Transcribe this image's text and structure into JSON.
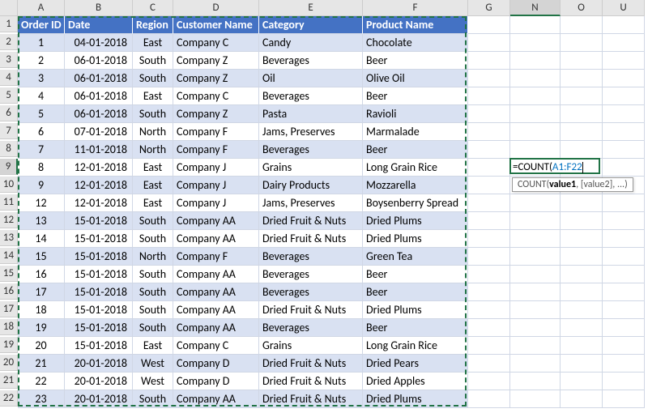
{
  "columns": [
    "A",
    "B",
    "C",
    "D",
    "E",
    "F",
    "G",
    "N",
    "O",
    "U"
  ],
  "active_column": "N",
  "active_row": 9,
  "headers": [
    "Order ID",
    "Date",
    "Region",
    "Customer Name",
    "Category",
    "Product Name"
  ],
  "rows": [
    {
      "n": 1,
      "id": "1",
      "date": "04-01-2018",
      "region": "East",
      "cust": "Company C",
      "cat": "Candy",
      "prod": "Chocolate"
    },
    {
      "n": 2,
      "id": "2",
      "date": "06-01-2018",
      "region": "South",
      "cust": "Company Z",
      "cat": "Beverages",
      "prod": "Beer"
    },
    {
      "n": 3,
      "id": "3",
      "date": "06-01-2018",
      "region": "South",
      "cust": "Company Z",
      "cat": "Oil",
      "prod": "Olive Oil"
    },
    {
      "n": 4,
      "id": "4",
      "date": "06-01-2018",
      "region": "East",
      "cust": "Company C",
      "cat": "Beverages",
      "prod": "Beer"
    },
    {
      "n": 5,
      "id": "5",
      "date": "06-01-2018",
      "region": "South",
      "cust": "Company Z",
      "cat": "Pasta",
      "prod": "Ravioli"
    },
    {
      "n": 6,
      "id": "6",
      "date": "07-01-2018",
      "region": "North",
      "cust": "Company F",
      "cat": "Jams, Preserves",
      "prod": "Marmalade"
    },
    {
      "n": 7,
      "id": "7",
      "date": "11-01-2018",
      "region": "North",
      "cust": "Company F",
      "cat": "Beverages",
      "prod": "Beer"
    },
    {
      "n": 8,
      "id": "8",
      "date": "12-01-2018",
      "region": "East",
      "cust": "Company J",
      "cat": "Grains",
      "prod": "Long Grain Rice"
    },
    {
      "n": 9,
      "id": "9",
      "date": "12-01-2018",
      "region": "East",
      "cust": "Company J",
      "cat": "Dairy Products",
      "prod": "Mozzarella"
    },
    {
      "n": 10,
      "id": "12",
      "date": "12-01-2018",
      "region": "East",
      "cust": "Company J",
      "cat": "Jams, Preserves",
      "prod": "Boysenberry Spread"
    },
    {
      "n": 11,
      "id": "13",
      "date": "15-01-2018",
      "region": "South",
      "cust": "Company AA",
      "cat": "Dried Fruit & Nuts",
      "prod": "Dried Plums"
    },
    {
      "n": 12,
      "id": "14",
      "date": "15-01-2018",
      "region": "South",
      "cust": "Company AA",
      "cat": "Dried Fruit & Nuts",
      "prod": "Dried Plums"
    },
    {
      "n": 13,
      "id": "15",
      "date": "15-01-2018",
      "region": "North",
      "cust": "Company F",
      "cat": "Beverages",
      "prod": "Green Tea"
    },
    {
      "n": 14,
      "id": "16",
      "date": "15-01-2018",
      "region": "South",
      "cust": "Company AA",
      "cat": "Beverages",
      "prod": "Beer"
    },
    {
      "n": 15,
      "id": "17",
      "date": "15-01-2018",
      "region": "South",
      "cust": "Company AA",
      "cat": "Beverages",
      "prod": "Beer"
    },
    {
      "n": 16,
      "id": "18",
      "date": "15-01-2018",
      "region": "South",
      "cust": "Company AA",
      "cat": "Dried Fruit & Nuts",
      "prod": "Dried Plums"
    },
    {
      "n": 17,
      "id": "19",
      "date": "15-01-2018",
      "region": "South",
      "cust": "Company AA",
      "cat": "Beverages",
      "prod": "Beer"
    },
    {
      "n": 18,
      "id": "20",
      "date": "15-01-2018",
      "region": "East",
      "cust": "Company C",
      "cat": "Grains",
      "prod": "Long Grain Rice"
    },
    {
      "n": 19,
      "id": "21",
      "date": "20-01-2018",
      "region": "West",
      "cust": "Company D",
      "cat": "Dried Fruit & Nuts",
      "prod": "Dried Pears"
    },
    {
      "n": 20,
      "id": "22",
      "date": "20-01-2018",
      "region": "West",
      "cust": "Company D",
      "cat": "Dried Fruit & Nuts",
      "prod": "Dried Apples"
    },
    {
      "n": 21,
      "id": "23",
      "date": "20-01-2018",
      "region": "South",
      "cust": "Company AA",
      "cat": "Dried Fruit & Nuts",
      "prod": "Dried Plums"
    }
  ],
  "formula": {
    "prefix": "=COUNT(",
    "ref": "A1:F22"
  },
  "tooltip": {
    "fn": "COUNT(",
    "arg1": "value1",
    "rest": ", [value2], ...)"
  },
  "chart_data": {
    "type": "table",
    "title": "",
    "columns": [
      "Order ID",
      "Date",
      "Region",
      "Customer Name",
      "Category",
      "Product Name"
    ],
    "data": [
      [
        1,
        "04-01-2018",
        "East",
        "Company C",
        "Candy",
        "Chocolate"
      ],
      [
        2,
        "06-01-2018",
        "South",
        "Company Z",
        "Beverages",
        "Beer"
      ],
      [
        3,
        "06-01-2018",
        "South",
        "Company Z",
        "Oil",
        "Olive Oil"
      ],
      [
        4,
        "06-01-2018",
        "East",
        "Company C",
        "Beverages",
        "Beer"
      ],
      [
        5,
        "06-01-2018",
        "South",
        "Company Z",
        "Pasta",
        "Ravioli"
      ],
      [
        6,
        "07-01-2018",
        "North",
        "Company F",
        "Jams, Preserves",
        "Marmalade"
      ],
      [
        7,
        "11-01-2018",
        "North",
        "Company F",
        "Beverages",
        "Beer"
      ],
      [
        8,
        "12-01-2018",
        "East",
        "Company J",
        "Grains",
        "Long Grain Rice"
      ],
      [
        9,
        "12-01-2018",
        "East",
        "Company J",
        "Dairy Products",
        "Mozzarella"
      ],
      [
        12,
        "12-01-2018",
        "East",
        "Company J",
        "Jams, Preserves",
        "Boysenberry Spread"
      ],
      [
        13,
        "15-01-2018",
        "South",
        "Company AA",
        "Dried Fruit & Nuts",
        "Dried Plums"
      ],
      [
        14,
        "15-01-2018",
        "South",
        "Company AA",
        "Dried Fruit & Nuts",
        "Dried Plums"
      ],
      [
        15,
        "15-01-2018",
        "North",
        "Company F",
        "Beverages",
        "Green Tea"
      ],
      [
        16,
        "15-01-2018",
        "South",
        "Company AA",
        "Beverages",
        "Beer"
      ],
      [
        17,
        "15-01-2018",
        "South",
        "Company AA",
        "Beverages",
        "Beer"
      ],
      [
        18,
        "15-01-2018",
        "South",
        "Company AA",
        "Dried Fruit & Nuts",
        "Dried Plums"
      ],
      [
        19,
        "15-01-2018",
        "South",
        "Company AA",
        "Beverages",
        "Beer"
      ],
      [
        20,
        "15-01-2018",
        "East",
        "Company C",
        "Grains",
        "Long Grain Rice"
      ],
      [
        21,
        "20-01-2018",
        "West",
        "Company D",
        "Dried Fruit & Nuts",
        "Dried Pears"
      ],
      [
        22,
        "20-01-2018",
        "West",
        "Company D",
        "Dried Fruit & Nuts",
        "Dried Apples"
      ],
      [
        23,
        "20-01-2018",
        "South",
        "Company AA",
        "Dried Fruit & Nuts",
        "Dried Plums"
      ]
    ]
  }
}
